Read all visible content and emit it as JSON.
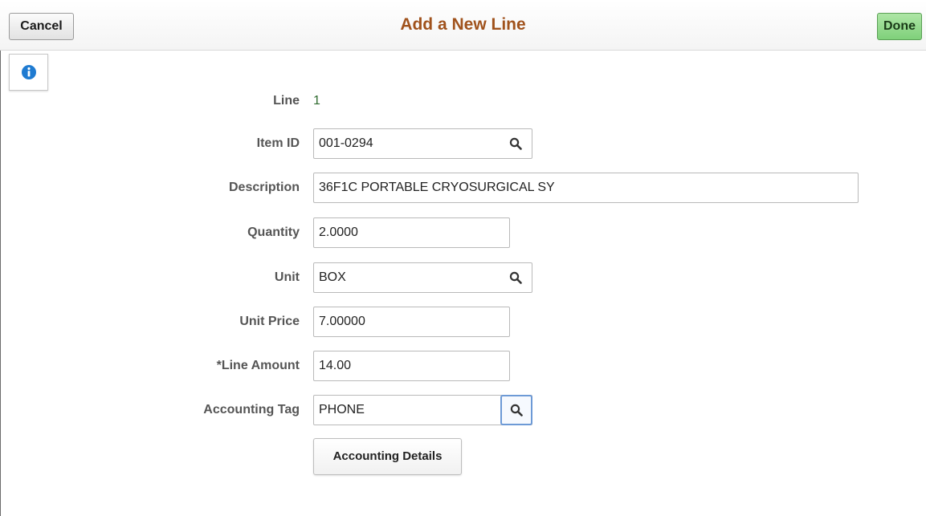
{
  "header": {
    "cancel_label": "Cancel",
    "title": "Add a New Line",
    "done_label": "Done"
  },
  "info": {
    "icon": "info-icon"
  },
  "form": {
    "line": {
      "label": "Line",
      "value": "1"
    },
    "item_id": {
      "label": "Item ID",
      "value": "001-0294",
      "icon": "search-icon"
    },
    "description": {
      "label": "Description",
      "value": "36F1C PORTABLE CRYOSURGICAL SY"
    },
    "quantity": {
      "label": "Quantity",
      "value": "2.0000"
    },
    "unit": {
      "label": "Unit",
      "value": "BOX",
      "icon": "search-icon"
    },
    "unit_price": {
      "label": "Unit Price",
      "value": "7.00000"
    },
    "line_amount": {
      "label": "*Line Amount",
      "value": "14.00"
    },
    "accounting_tag": {
      "label": "Accounting Tag",
      "value": "PHONE",
      "icon": "search-icon"
    },
    "accounting_details_label": "Accounting Details"
  },
  "colors": {
    "title": "#a0521c",
    "done_button": "#7fd07a",
    "info_icon": "#1f7bd1",
    "line_value": "#2f6b2f"
  }
}
